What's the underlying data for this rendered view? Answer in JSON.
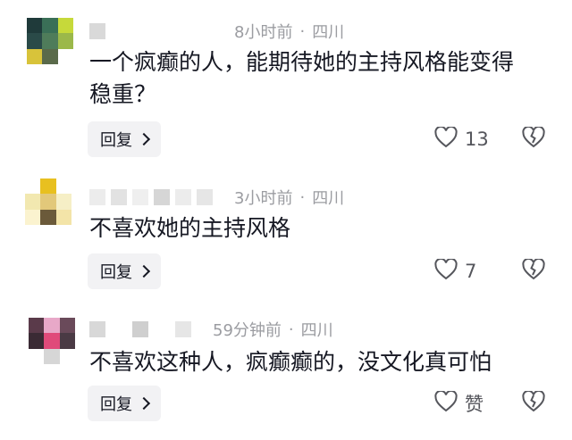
{
  "comments": [
    {
      "meta": {
        "time": "8小时前",
        "location": "四川"
      },
      "text_line1": "一个疯癫的人，能期待她的主持风格能变得",
      "text_line2": "稳重？",
      "reply_label": "回复",
      "like_count": "13"
    },
    {
      "meta": {
        "time": "3小时前",
        "location": "四川"
      },
      "text_line1": "不喜欢她的主持风格",
      "reply_label": "回复",
      "like_count": "7"
    },
    {
      "meta": {
        "time": "59分钟前",
        "location": "四川"
      },
      "text_line1": "不喜欢这种人，疯癫癫的，没文化真可怕",
      "reply_label": "回复",
      "like_count": "赞"
    }
  ],
  "separator": "·",
  "icons": {
    "reply_chevron": "chevron-right-icon",
    "like": "heart-outline-icon",
    "dislike": "broken-heart-icon"
  },
  "colors": {
    "text": "#161823",
    "meta": "#9b9ca1",
    "reply_bg": "#f2f2f4",
    "icon": "#55565c"
  }
}
